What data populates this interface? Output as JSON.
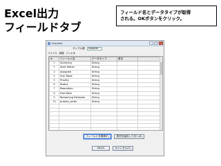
{
  "slide": {
    "title_line1": "Excel出力",
    "title_line2": "フィールドタブ",
    "callout_line1": "フィールド名とデータタイプが取得",
    "callout_line2": "される。OKボタンをクリック。"
  },
  "dialog": {
    "window_title": "DataEdit",
    "sample_label": "サンプル数",
    "sample_value": "DataEdit",
    "menu_items": [
      "ファイル",
      "詳細",
      "フィルタ"
    ],
    "columns": [
      "#",
      "フィールド名",
      "データタイプ",
      "書式"
    ],
    "rows": [
      {
        "num": "1",
        "field": "Summary",
        "type": "String",
        "format": ""
      },
      {
        "num": "2",
        "field": "Start Metric",
        "type": "String",
        "format": ""
      },
      {
        "num": "3",
        "field": "Assignee",
        "type": "String",
        "format": ""
      },
      {
        "num": "4",
        "field": "Sub Tasks",
        "type": "String",
        "format": ""
      },
      {
        "num": "5",
        "field": "Priority",
        "type": "String",
        "format": ""
      },
      {
        "num": "6",
        "field": "Status",
        "type": "String",
        "format": ""
      },
      {
        "num": "7",
        "field": "Resolution",
        "type": "String",
        "format": ""
      },
      {
        "num": "8",
        "field": "Due Date",
        "type": "String",
        "format": ""
      },
      {
        "num": "9",
        "field": "Remaining Estimate",
        "type": "String",
        "format": ""
      },
      {
        "num": "10",
        "field": "priority_order",
        "type": "String",
        "format": ""
      }
    ],
    "get_fields_button": "フィールドを取得(F)",
    "save_button": "書式を保存して次へ(S)",
    "ok_button": "OK(O)",
    "cancel_button": "キャンセル(C)"
  }
}
